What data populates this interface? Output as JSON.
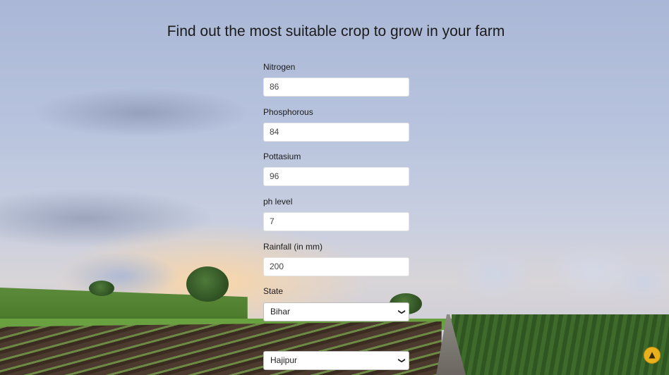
{
  "page": {
    "title": "Find out the most suitable crop to grow in your farm"
  },
  "form": {
    "nitrogen": {
      "label": "Nitrogen",
      "value": "86"
    },
    "phosphorous": {
      "label": "Phosphorous",
      "value": "84"
    },
    "pottasium": {
      "label": "Pottasium",
      "value": "96"
    },
    "ph": {
      "label": "ph level",
      "value": "7"
    },
    "rainfall": {
      "label": "Rainfall (in mm)",
      "value": "200"
    },
    "state": {
      "label": "State",
      "selected": "Bihar"
    },
    "city": {
      "selected": "Hajipur"
    }
  },
  "scroll_top": {
    "icon": "chevron-up-icon",
    "color": "#e9b21c"
  }
}
